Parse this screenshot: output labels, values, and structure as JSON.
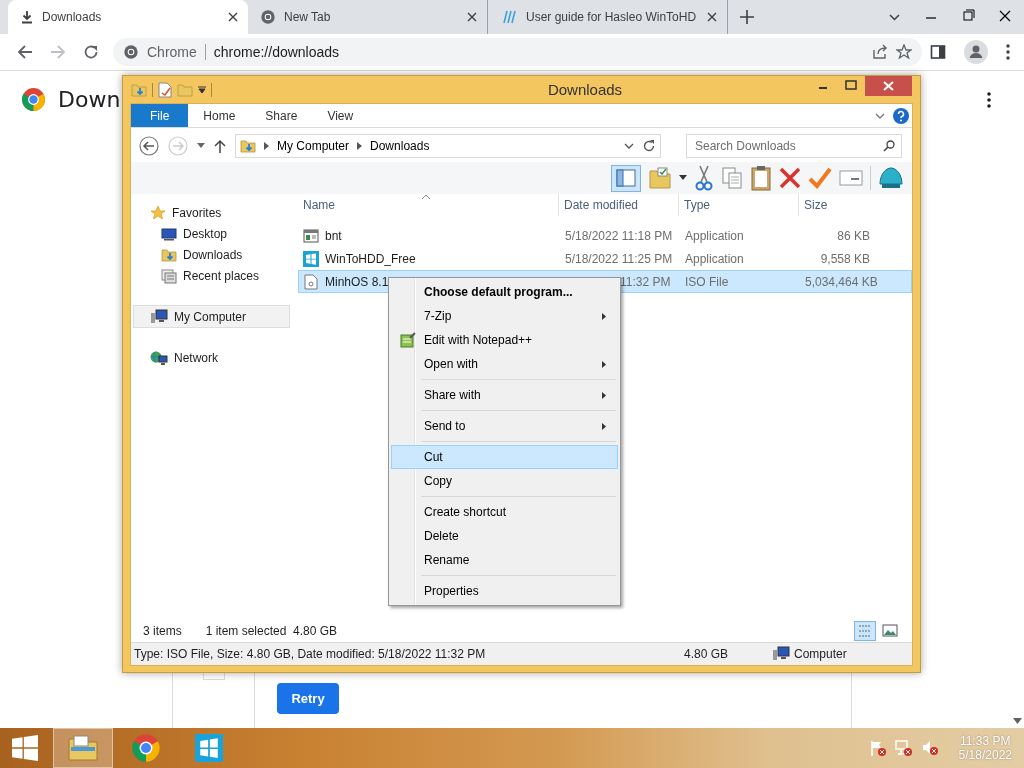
{
  "browser": {
    "tabs": [
      {
        "title": "Downloads",
        "kind": "download",
        "selected": true
      },
      {
        "title": "New Tab",
        "kind": "chrome",
        "selected": false
      },
      {
        "title": "User guide for Hasleo WinToHD",
        "kind": "hasleo",
        "selected": false
      }
    ],
    "omnibox": {
      "site": "Chrome",
      "url": "chrome://downloads"
    },
    "page": {
      "heading": "Down",
      "button": "Retry"
    }
  },
  "explorer": {
    "title": "Downloads",
    "ribbon_tabs": [
      {
        "label": "File",
        "selected": true
      },
      {
        "label": "Home",
        "selected": false
      },
      {
        "label": "Share",
        "selected": false
      },
      {
        "label": "View",
        "selected": false
      }
    ],
    "breadcrumb": [
      "My Computer",
      "Downloads"
    ],
    "search": {
      "placeholder": "Search Downloads"
    },
    "nav": [
      {
        "label": "Favorites",
        "kind": "favorites",
        "selected": false,
        "children": [
          {
            "label": "Desktop",
            "kind": "desktop",
            "selected": false
          },
          {
            "label": "Downloads",
            "kind": "downloads",
            "selected": false
          },
          {
            "label": "Recent places",
            "kind": "recent",
            "selected": false
          }
        ]
      },
      {
        "label": "My Computer",
        "kind": "computer",
        "selected": true
      },
      {
        "label": "Network",
        "kind": "network",
        "selected": false
      }
    ],
    "columns": [
      "Name",
      "Date modified",
      "Type",
      "Size"
    ],
    "rows": [
      {
        "name": "bnt",
        "kind": "program",
        "date": "5/18/2022 11:18 PM",
        "type": "Application",
        "size": "86 KB",
        "selected": false
      },
      {
        "name": "WinToHDD_Free",
        "kind": "installer",
        "date": "5/18/2022 11:25 PM",
        "type": "Application",
        "size": "9,558 KB",
        "selected": false
      },
      {
        "name": "MinhOS 8.1",
        "kind": "disc-image",
        "date": "11:32 PM",
        "type": "ISO File",
        "size": "5,034,464 KB",
        "selected": true
      }
    ],
    "status": {
      "count": "3 items",
      "selection": "1 item selected  4.80 GB"
    },
    "details": {
      "summary": "Type: ISO File, Size: 4.80 GB, Date modified: 5/18/2022 11:32 PM",
      "size": "4.80 GB",
      "location": "Computer"
    }
  },
  "context_menu": {
    "groups": [
      {
        "items": [
          {
            "label": "Choose default program...",
            "kind": "default",
            "submenu": false,
            "selected": false
          },
          {
            "label": "7-Zip",
            "kind": "plain",
            "submenu": true,
            "selected": false
          },
          {
            "label": "Edit with Notepad++",
            "kind": "with-icon",
            "submenu": false,
            "selected": false
          },
          {
            "label": "Open with",
            "kind": "plain",
            "submenu": true,
            "selected": false
          }
        ]
      },
      {
        "items": [
          {
            "label": "Share with",
            "kind": "plain",
            "submenu": true,
            "selected": false
          }
        ]
      },
      {
        "items": [
          {
            "label": "Send to",
            "kind": "plain",
            "submenu": true,
            "selected": false
          }
        ]
      },
      {
        "items": [
          {
            "label": "Cut",
            "kind": "plain",
            "submenu": false,
            "selected": true
          },
          {
            "label": "Copy",
            "kind": "plain",
            "submenu": false,
            "selected": false
          }
        ]
      },
      {
        "items": [
          {
            "label": "Create shortcut",
            "kind": "plain",
            "submenu": false,
            "selected": false
          },
          {
            "label": "Delete",
            "kind": "plain",
            "submenu": false,
            "selected": false
          },
          {
            "label": "Rename",
            "kind": "plain",
            "submenu": false,
            "selected": false
          }
        ]
      },
      {
        "items": [
          {
            "label": "Properties",
            "kind": "plain",
            "submenu": false,
            "selected": false
          }
        ]
      }
    ]
  },
  "taskbar": {
    "apps": [
      {
        "kind": "explorer",
        "selected": true
      },
      {
        "kind": "chrome",
        "selected": false
      },
      {
        "kind": "wintohdd",
        "selected": false
      }
    ],
    "time": "11:33 PM",
    "date": "5/18/2022"
  }
}
